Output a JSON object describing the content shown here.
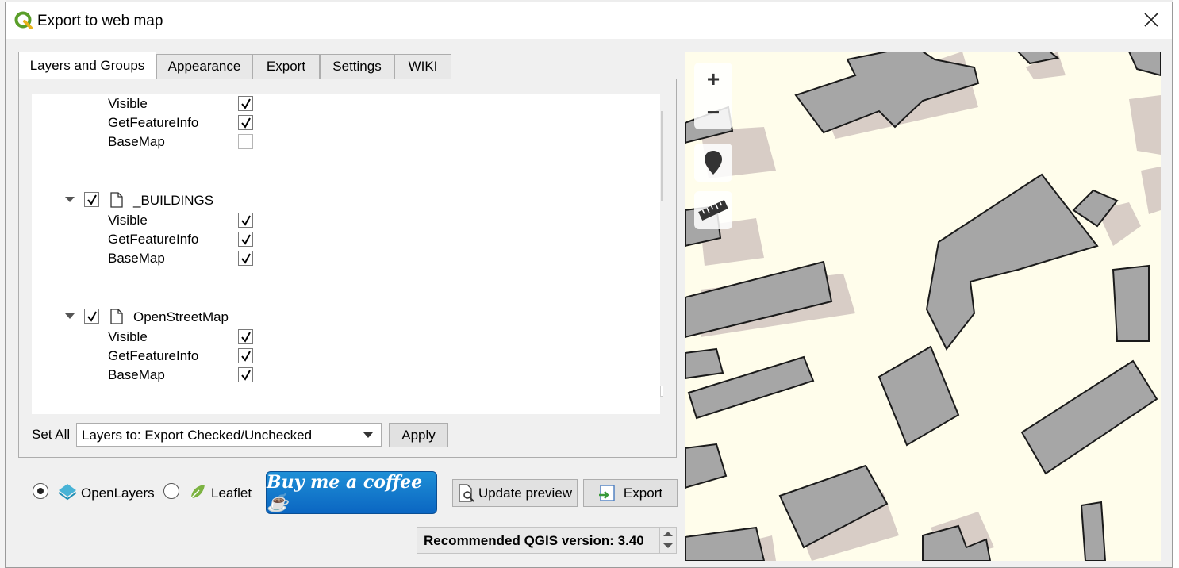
{
  "window": {
    "title": "Export to web map",
    "close_icon": "close-icon"
  },
  "tabs": [
    {
      "label": "Layers and Groups",
      "active": true
    },
    {
      "label": "Appearance",
      "active": false
    },
    {
      "label": "Export",
      "active": false
    },
    {
      "label": "Settings",
      "active": false
    },
    {
      "label": "WIKI",
      "active": false
    }
  ],
  "tree": {
    "first_layer": {
      "options": [
        {
          "label": "Visible",
          "checked": true
        },
        {
          "label": "GetFeatureInfo",
          "checked": true
        },
        {
          "label": "BaseMap",
          "checked": false
        }
      ]
    },
    "layers": [
      {
        "name": "_BUILDINGS",
        "checked": true,
        "options": [
          {
            "label": "Visible",
            "checked": true
          },
          {
            "label": "GetFeatureInfo",
            "checked": true
          },
          {
            "label": "BaseMap",
            "checked": true
          }
        ]
      },
      {
        "name": "OpenStreetMap",
        "checked": true,
        "options": [
          {
            "label": "Visible",
            "checked": true
          },
          {
            "label": "GetFeatureInfo",
            "checked": true
          },
          {
            "label": "BaseMap",
            "checked": true
          }
        ]
      }
    ]
  },
  "set_all": {
    "label": "Set All",
    "combo_value": "Layers to: Export Checked/Unchecked",
    "apply_label": "Apply"
  },
  "bottom": {
    "radio_openlayers": "OpenLayers",
    "radio_leaflet": "Leaflet",
    "selected_engine": "OpenLayers",
    "coffee_label": "Buy me a coffee ☕",
    "update_preview_label": "Update preview",
    "export_label": "Export",
    "version_text": "Recommended QGIS version: 3.40"
  },
  "map": {
    "zoom_in": "+",
    "zoom_out": "−",
    "controls": [
      "zoom-in-icon",
      "zoom-out-icon",
      "map-marker-icon",
      "ruler-icon"
    ],
    "colors": {
      "background": "#fffdeb",
      "building": "#a6a6a6",
      "shadow": "#d8cdc6"
    }
  }
}
